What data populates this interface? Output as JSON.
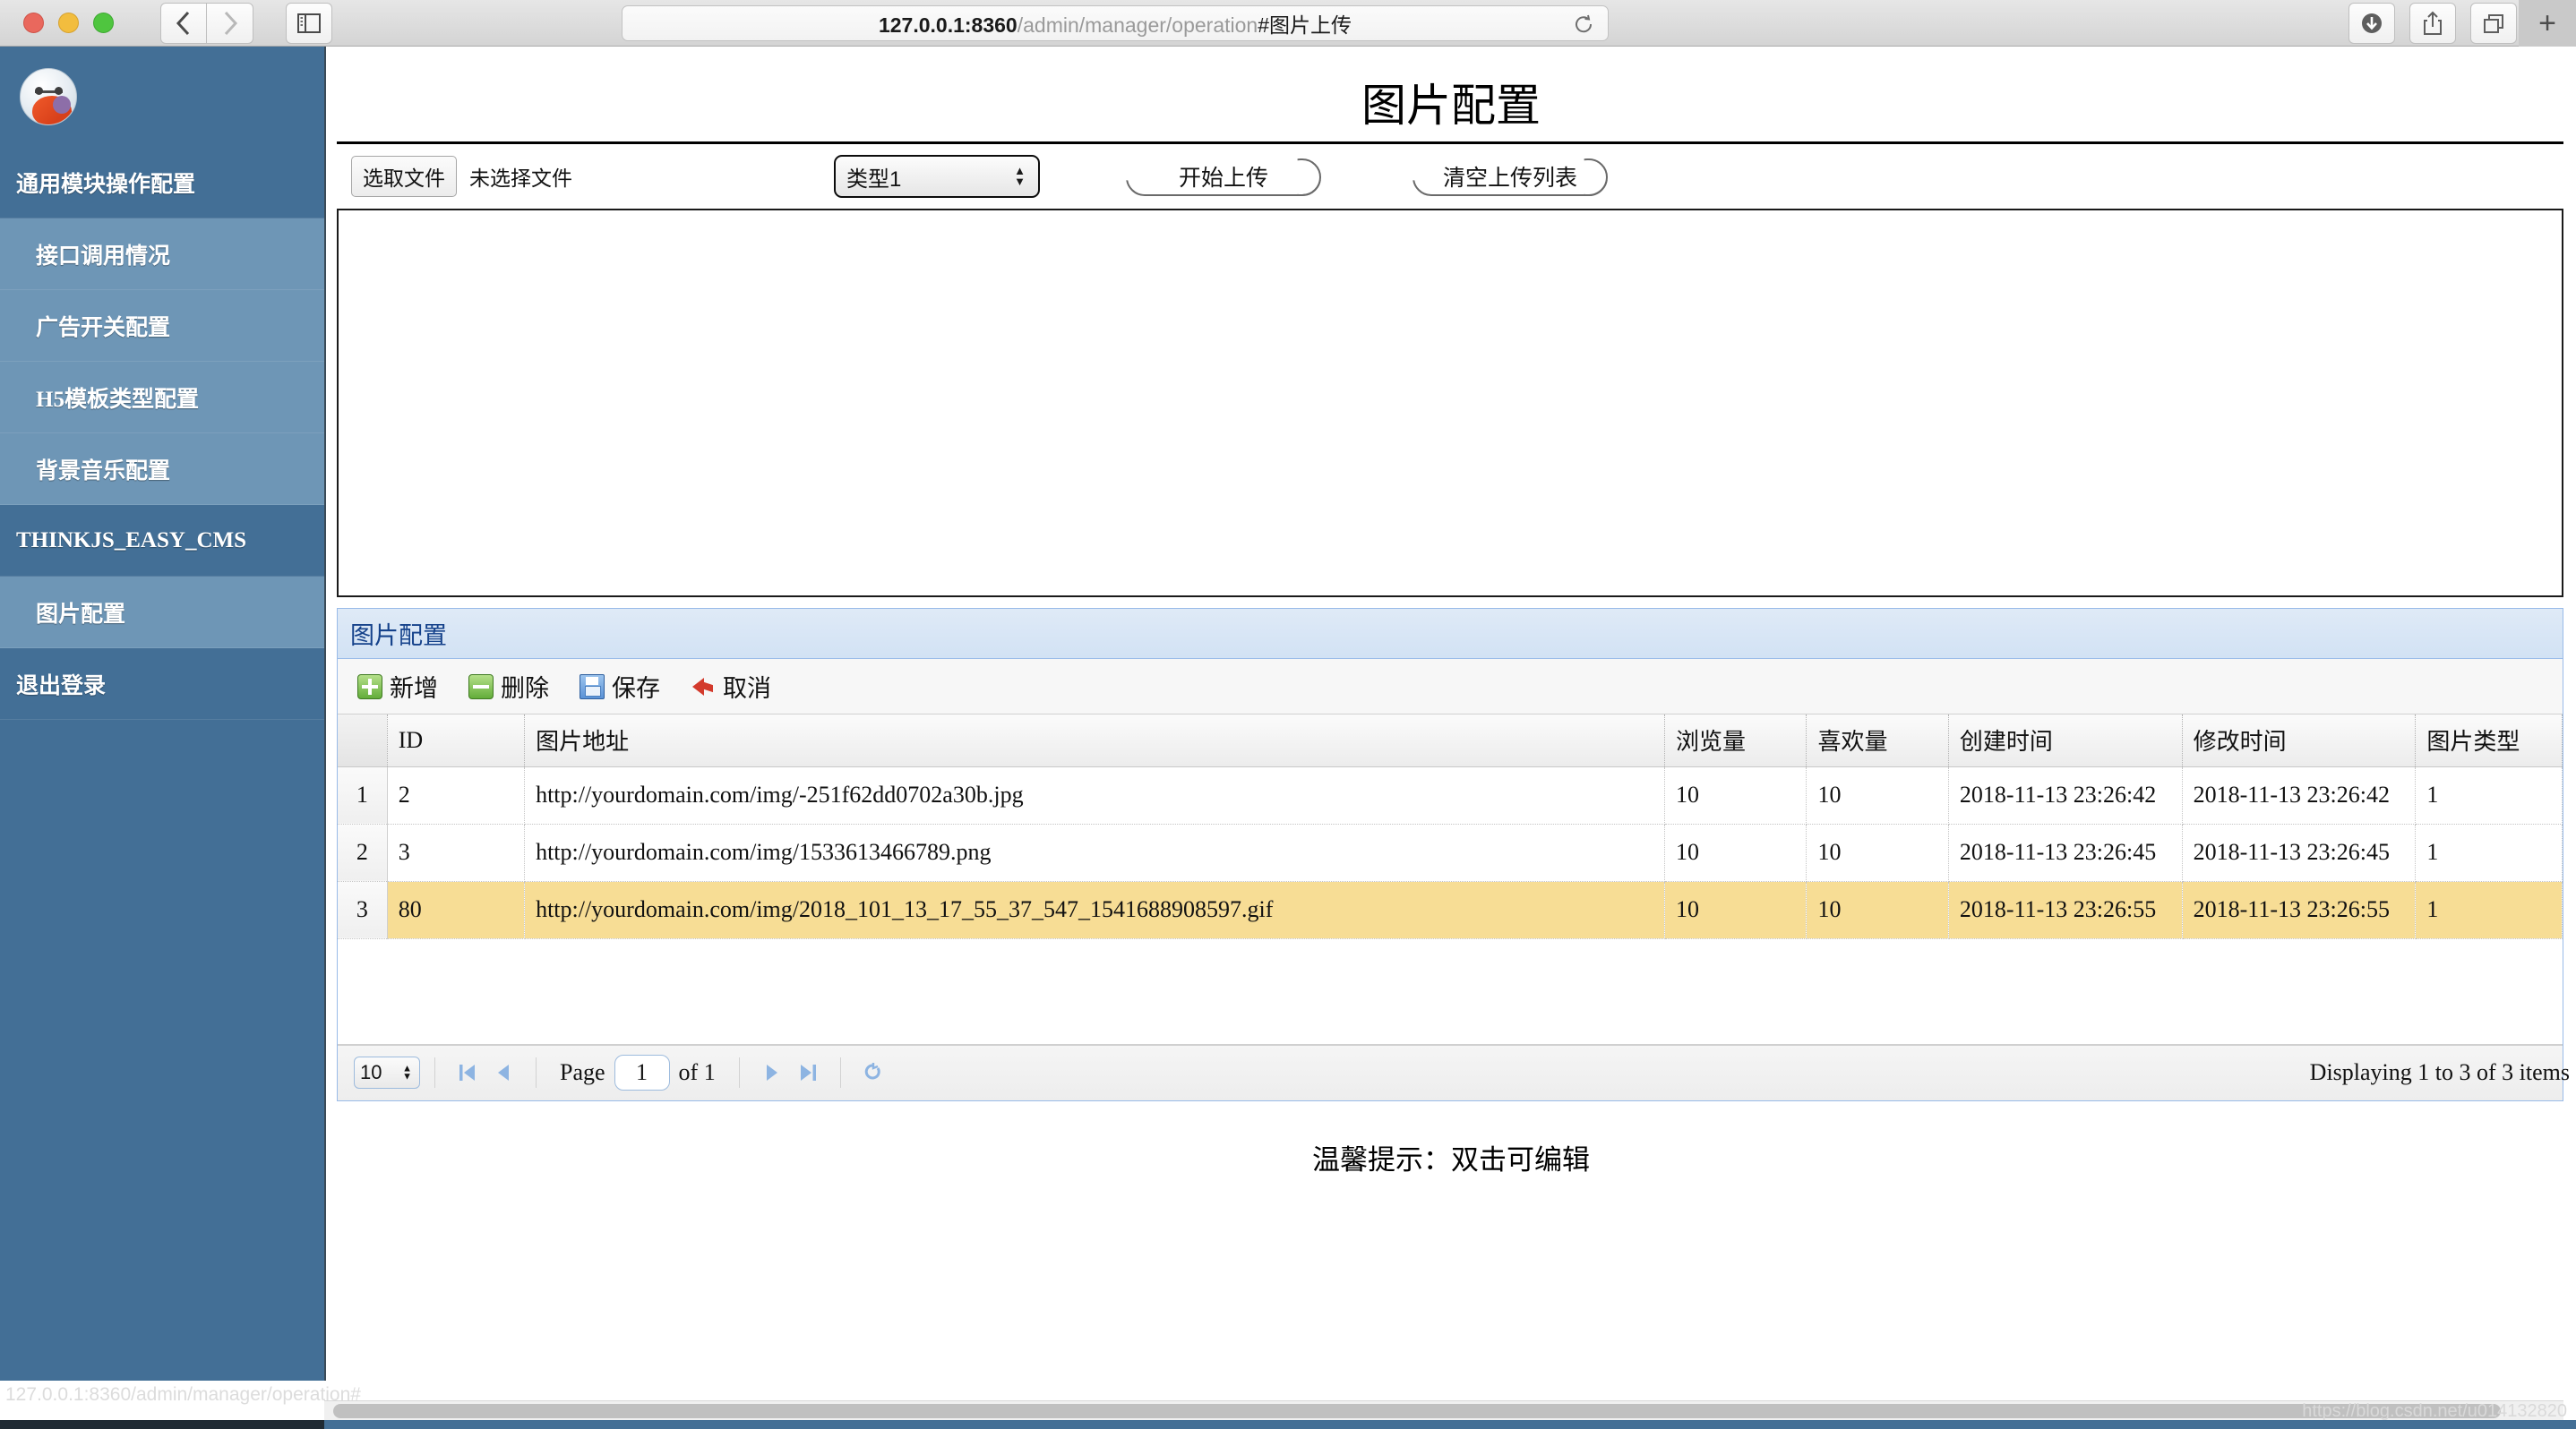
{
  "browser": {
    "url_host": "127.0.0.1:8360",
    "url_path": "/admin/manager/operation",
    "url_hash": "#图片上传",
    "back_icon": "chevron-left-icon",
    "forward_icon": "chevron-right-icon",
    "sidebar_toggle_icon": "sidebar-toggle-icon",
    "reload_icon": "reload-icon",
    "download_icon": "download-icon",
    "share_icon": "share-icon",
    "tabs_icon": "tab-overview-icon",
    "newtab_label": "+"
  },
  "sidebar": {
    "logo_icon": "baymax-avatar-icon",
    "items": [
      {
        "label": "通用模块操作配置",
        "type": "group"
      },
      {
        "label": "接口调用情况",
        "type": "child"
      },
      {
        "label": "广告开关配置",
        "type": "child"
      },
      {
        "label": "H5模板类型配置",
        "type": "child"
      },
      {
        "label": "背景音乐配置",
        "type": "child"
      },
      {
        "label": "THINKJS_EASY_CMS",
        "type": "group"
      },
      {
        "label": "图片配置",
        "type": "child"
      },
      {
        "label": "退出登录",
        "type": "group"
      }
    ]
  },
  "main": {
    "page_title": "图片配置",
    "upload": {
      "choose_file_label": "选取文件",
      "no_file_text": "未选择文件",
      "type_select_value": "类型1",
      "type_select_options": [
        "类型1"
      ],
      "start_upload_label": "开始上传",
      "clear_list_label": "清空上传列表"
    },
    "grid": {
      "panel_title": "图片配置",
      "toolbar": [
        {
          "label": "新增",
          "icon": "add-icon"
        },
        {
          "label": "删除",
          "icon": "delete-icon"
        },
        {
          "label": "保存",
          "icon": "save-icon"
        },
        {
          "label": "取消",
          "icon": "cancel-icon"
        }
      ],
      "columns": [
        "",
        "ID",
        "图片地址",
        "浏览量",
        "喜欢量",
        "创建时间",
        "修改时间",
        "图片类型"
      ],
      "rows": [
        {
          "num": "1",
          "id": "2",
          "url": "http://yourdomain.com/img/-251f62dd0702a30b.jpg",
          "views": "10",
          "likes": "10",
          "created": "2018-11-13 23:26:42",
          "modified": "2018-11-13 23:26:42",
          "type": "1",
          "selected": false
        },
        {
          "num": "2",
          "id": "3",
          "url": "http://yourdomain.com/img/1533613466789.png",
          "views": "10",
          "likes": "10",
          "created": "2018-11-13 23:26:45",
          "modified": "2018-11-13 23:26:45",
          "type": "1",
          "selected": false
        },
        {
          "num": "3",
          "id": "80",
          "url": "http://yourdomain.com/img/2018_101_13_17_55_37_547_1541688908597.gif",
          "views": "10",
          "likes": "10",
          "created": "2018-11-13 23:26:55",
          "modified": "2018-11-13 23:26:55",
          "type": "1",
          "selected": true
        }
      ],
      "pager": {
        "page_size": "10",
        "first_icon": "first-page-icon",
        "prev_icon": "prev-page-icon",
        "page_label": "Page",
        "page_number": "1",
        "of_label": "of 1",
        "next_icon": "next-page-icon",
        "last_icon": "last-page-icon",
        "refresh_icon": "refresh-icon",
        "display_info": "Displaying 1 to 3 of 3 items"
      }
    },
    "tip_text": "温馨提示：双击可编辑"
  },
  "footer": {
    "status_text": "127.0.0.1:8360/admin/manager/operation#",
    "watermark": "https://blog.csdn.net/u014132820"
  },
  "colors": {
    "sidebar_bg": "#436f96",
    "sidebar_child_bg": "#6e96b6",
    "panel_header": "#d2e2f4",
    "panel_title_text": "#15428b",
    "row_selected": "#f7dd95"
  }
}
